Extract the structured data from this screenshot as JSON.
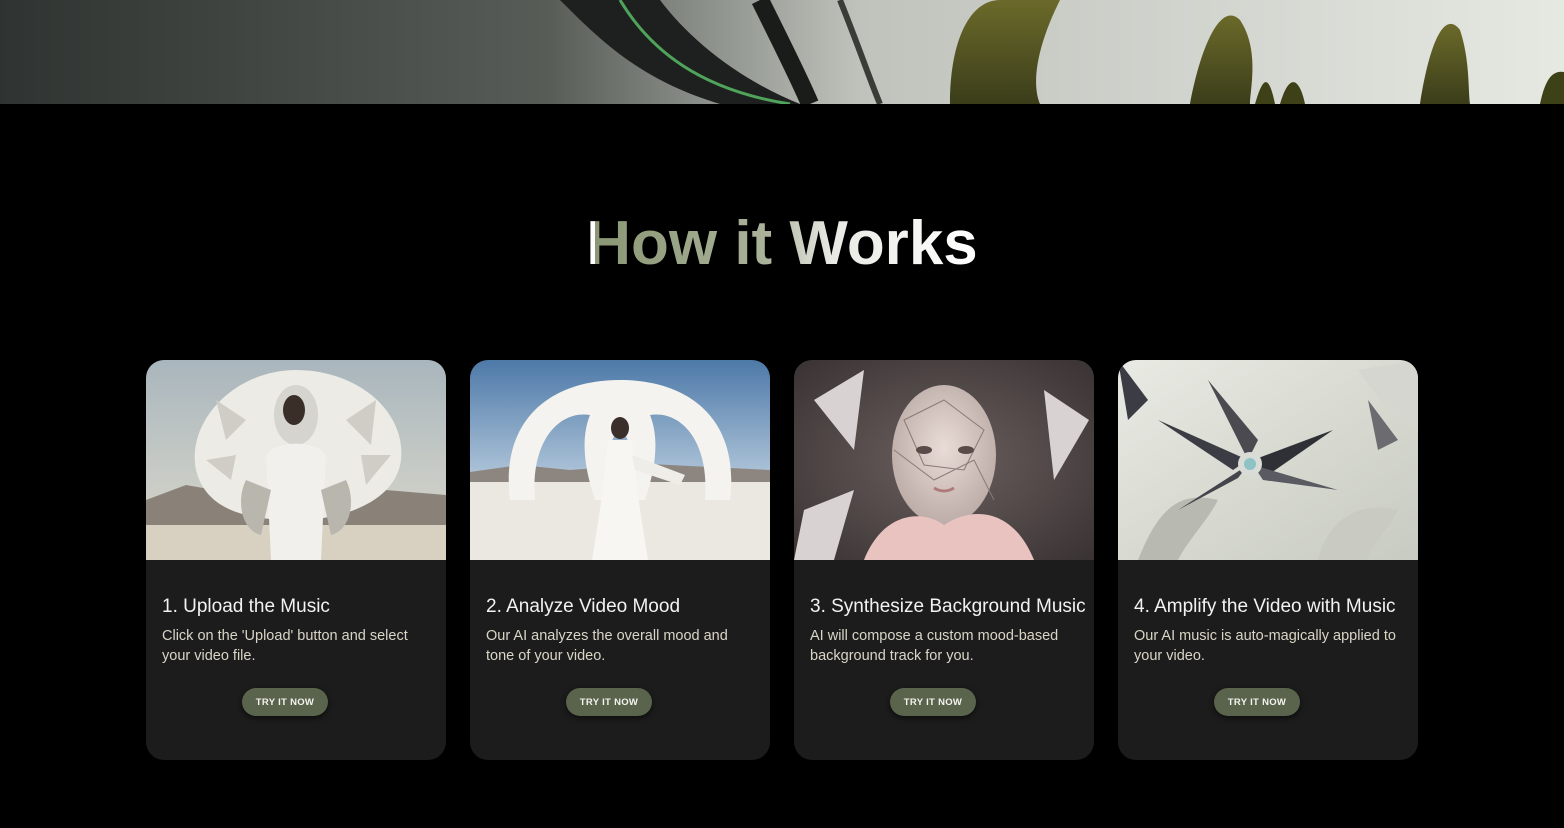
{
  "section": {
    "title": "How it Works"
  },
  "steps": [
    {
      "title": "1. Upload the Music",
      "description": "Click on the 'Upload' button and select your video file.",
      "button_label": "TRY IT NOW",
      "image": "sculptural-white-fashion-desert-photo"
    },
    {
      "title": "2. Analyze Video Mood",
      "description": "Our AI analyzes the overall mood and tone of your video.",
      "button_label": "TRY IT NOW",
      "image": "white-arch-figure-desert-photo"
    },
    {
      "title": "3. Synthesize Background Music",
      "description": "AI will compose a custom mood-based background track for you.",
      "button_label": "TRY IT NOW",
      "image": "porcelain-face-pink-fragments-photo"
    },
    {
      "title": "4. Amplify the Video with Music",
      "description": "Our AI music is auto-magically applied to your video.",
      "button_label": "TRY IT NOW",
      "image": "chrome-flower-sculpture-photo"
    }
  ],
  "colors": {
    "background": "#000000",
    "card": "#1c1c1c",
    "button": "#5a634b",
    "title_gradient_start": "#8a9774",
    "title_gradient_end": "#ffffff",
    "description_text": "#d9d6c7"
  }
}
